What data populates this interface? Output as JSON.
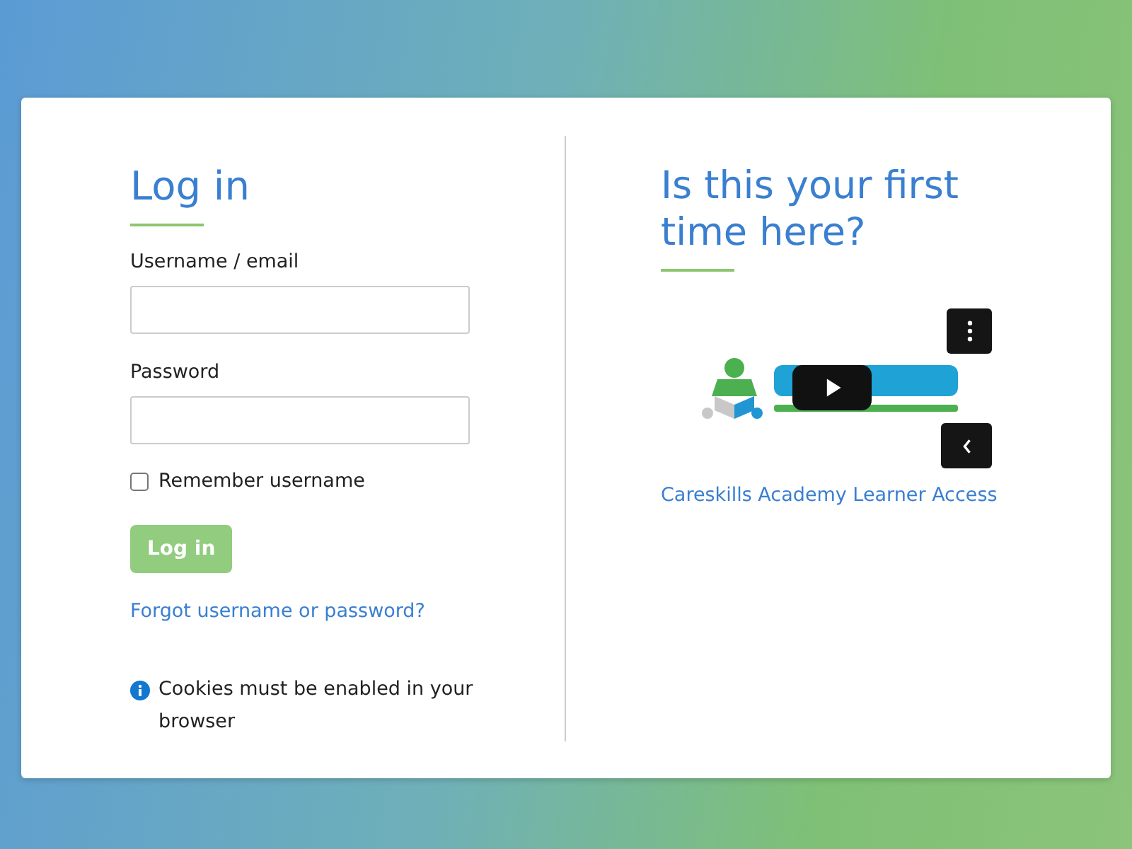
{
  "login": {
    "title": "Log in",
    "username_label": "Username / email",
    "password_label": "Password",
    "remember": {
      "label": "Remember username",
      "checked": false
    },
    "button": {
      "label": "Log in",
      "disabled": true
    },
    "forgot_link": "Forgot username or password?",
    "cookies_note": "Cookies must be enabled in your browser"
  },
  "first_time": {
    "title": "Is this your first time here?",
    "link": "Careskills Academy Learner Access"
  }
}
